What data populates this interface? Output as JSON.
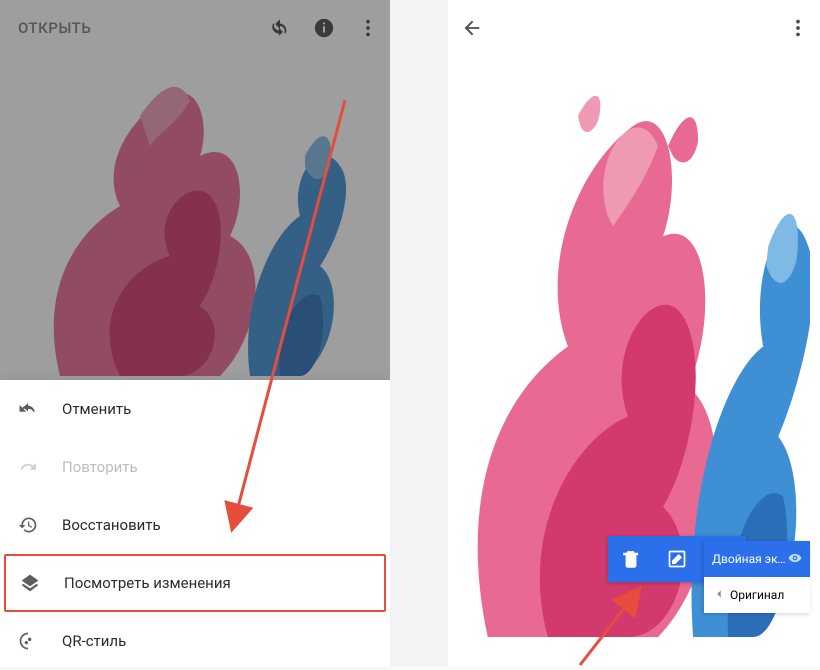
{
  "left": {
    "open_label": "ОТКРЫТЬ",
    "menu": {
      "undo": "Отменить",
      "redo": "Повторить",
      "restore": "Восстановить",
      "view_changes": "Посмотреть изменения",
      "qr_style": "QR-стиль"
    }
  },
  "right": {
    "layers": {
      "active": "Двойная экс…",
      "original": "Оригинал"
    }
  },
  "colors": {
    "accent": "#2b6fea",
    "highlight": "#e74c3c"
  }
}
